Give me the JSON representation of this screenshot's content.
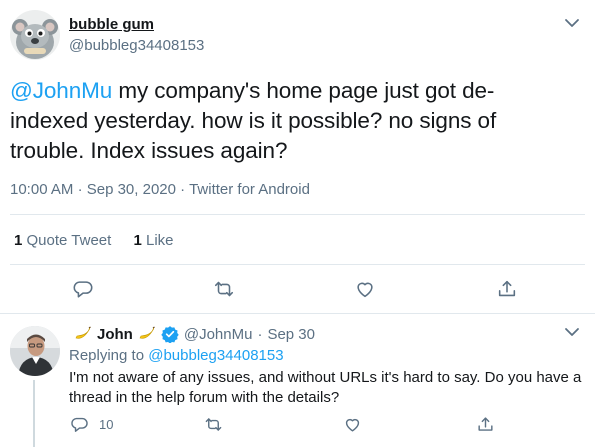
{
  "main_tweet": {
    "display_name": "bubble gum",
    "handle": "@bubbleg34408153",
    "text": {
      "mention": "@JohnMu",
      "line1_rest": " my company's home page just got de-",
      "line2": "indexed yesterday. how is it possible? no signs of",
      "line3": "trouble. Index issues again?"
    },
    "meta": {
      "time": "10:00 AM",
      "separator": "·",
      "date": "Sep 30, 2020",
      "source": "Twitter for Android"
    },
    "stats": {
      "quote_count": "1",
      "quote_label": "Quote Tweet",
      "like_count": "1",
      "like_label": "Like"
    },
    "actions": [
      "reply-icon",
      "retweet-icon",
      "like-icon",
      "share-icon"
    ]
  },
  "reply_tweet": {
    "display_name": "John",
    "handle": "@JohnMu",
    "separator": "·",
    "date": "Sep 30",
    "replying_prefix": "Replying to",
    "replying_to": "@bubbleg34408153",
    "text_line1": "I'm not aware of any issues, and without URLs it's hard to say. Do you have a",
    "text_line2": "thread in the help forum with the details?",
    "reply_count": "10",
    "actions": [
      "reply-icon",
      "retweet-icon",
      "like-icon",
      "share-icon"
    ]
  },
  "colors": {
    "link": "#1da1f2",
    "secondary_text": "#5b7083",
    "primary_text": "#14171a",
    "verified": "#1da1f2",
    "divider": "#e1e8ed"
  }
}
